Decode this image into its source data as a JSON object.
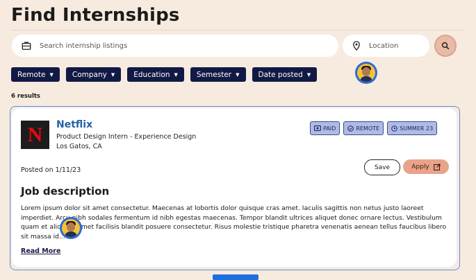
{
  "page": {
    "title": "Find Internships"
  },
  "search": {
    "placeholder": "Search internship listings",
    "location_placeholder": "Location",
    "icon": "briefcase-icon",
    "search_button_icon": "magnifier-icon"
  },
  "filters": [
    {
      "label": "Remote"
    },
    {
      "label": "Company"
    },
    {
      "label": "Education"
    },
    {
      "label": "Semester"
    },
    {
      "label": "Date posted"
    }
  ],
  "results": {
    "count_label": "6 results"
  },
  "listing": {
    "company": "Netflix",
    "logo_letter": "N",
    "role": "Product Design Intern - Experience Design",
    "location": "Los Gatos, CA",
    "badges": [
      {
        "label": "PAID",
        "icon": "cash-icon"
      },
      {
        "label": "REMOTE",
        "icon": "check-circle-icon"
      },
      {
        "label": "SUMMER 23",
        "icon": "clock-icon"
      }
    ],
    "posted": "Posted on 1/11/23",
    "save_label": "Save",
    "apply_label": "Apply",
    "description_heading": "Job description",
    "description": "Lorem ipsum dolor sit amet consectetur. Maecenas at lobortis dolor quisque cras amet. Iaculis sagittis non netus justo laoreet imperdiet. Arcu nibh sodales fermentum id nibh egestas maecenas. Tempor blandit ultrices aliquet donec ornare lectus. Vestibulum quam et aliquam amet facilisis blandit posuere consectetur. Risus molestie tristique pharetra venenatis aenean tellus faucibus libero sit massa id...",
    "read_more": "Read More"
  },
  "colors": {
    "background": "#f7ebe0",
    "chip": "#111a44",
    "accent_blue": "#2560a8",
    "apply": "#e9a38a",
    "badge": "#aebbe6"
  }
}
